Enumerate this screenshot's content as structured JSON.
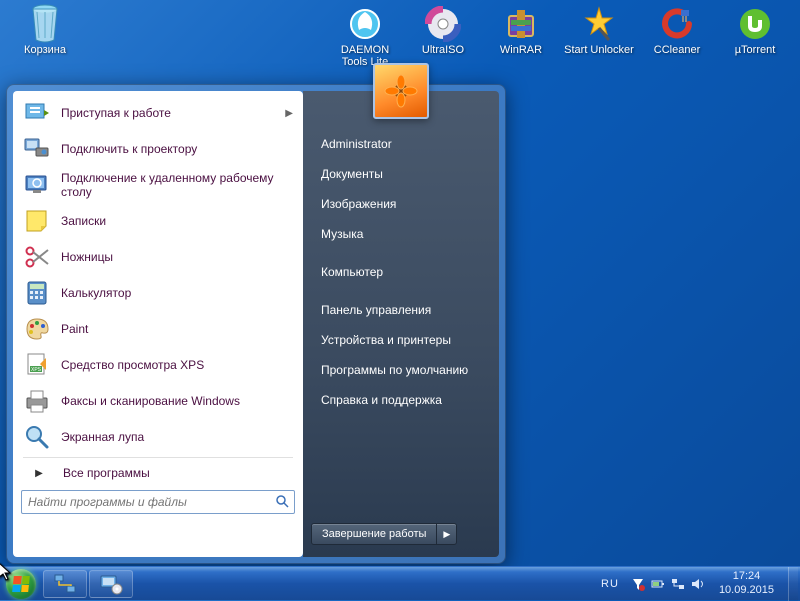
{
  "desktop": {
    "icons": [
      {
        "id": "recycle-bin",
        "label": "Корзина"
      },
      {
        "id": "daemon-tools",
        "label": "DAEMON Tools Lite"
      },
      {
        "id": "ultraiso",
        "label": "UltraISO"
      },
      {
        "id": "winrar",
        "label": "WinRAR"
      },
      {
        "id": "start-unlocker",
        "label": "Start Unlocker"
      },
      {
        "id": "ccleaner",
        "label": "CCleaner"
      },
      {
        "id": "utorrent",
        "label": "µTorrent"
      }
    ]
  },
  "start_menu": {
    "left_items": [
      {
        "id": "getting-started",
        "label": "Приступая к работе",
        "has_submenu": true
      },
      {
        "id": "connect-projector",
        "label": "Подключить к проектору"
      },
      {
        "id": "remote-desktop",
        "label": "Подключение к удаленному рабочему столу"
      },
      {
        "id": "sticky-notes",
        "label": "Записки"
      },
      {
        "id": "snipping-tool",
        "label": "Ножницы"
      },
      {
        "id": "calculator",
        "label": "Калькулятор"
      },
      {
        "id": "paint",
        "label": "Paint"
      },
      {
        "id": "xps-viewer",
        "label": "Средство просмотра XPS"
      },
      {
        "id": "fax-scan",
        "label": "Факсы и сканирование Windows"
      },
      {
        "id": "magnifier",
        "label": "Экранная лупа"
      }
    ],
    "all_programs": "Все программы",
    "search_placeholder": "Найти программы и файлы",
    "right_links": {
      "user": "Administrator",
      "documents": "Документы",
      "pictures": "Изображения",
      "music": "Музыка",
      "computer": "Компьютер",
      "control_panel": "Панель управления",
      "devices_printers": "Устройства и принтеры",
      "default_programs": "Программы по умолчанию",
      "help": "Справка и поддержка"
    },
    "shutdown": "Завершение работы"
  },
  "taskbar": {
    "language": "RU",
    "time": "17:24",
    "date": "10.09.2015"
  }
}
